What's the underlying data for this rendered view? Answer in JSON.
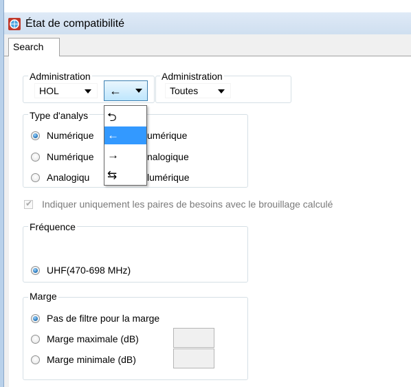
{
  "window": {
    "title": "État de compatibilité"
  },
  "tabs": [
    {
      "label": "Search"
    }
  ],
  "admin1": {
    "legend": "Administration",
    "value": "HOL"
  },
  "direction_combo": {
    "value": "←"
  },
  "admin2": {
    "legend": "Administration",
    "value": "Toutes"
  },
  "direction_options": [
    {
      "label": "⮌",
      "selected": false
    },
    {
      "label": "←",
      "selected": true
    },
    {
      "label": "→",
      "selected": false
    },
    {
      "label": "⇆",
      "selected": false
    }
  ],
  "analysis": {
    "legend": "Type d'analys",
    "options": [
      {
        "left": "Numérique",
        "right": "umérique",
        "selected": true
      },
      {
        "left": "Numérique",
        "right": "nalogique",
        "selected": false
      },
      {
        "left": "Analogiqu",
        "right": "lumérique",
        "selected": false
      }
    ]
  },
  "checkbox": {
    "label": "Indiquer uniquement les paires de besoins avec le brouillage calculé",
    "checked": true,
    "enabled": false
  },
  "frequency": {
    "legend": "Fréquence",
    "options": [
      {
        "label": "UHF(470-698 MHz)",
        "selected": true
      }
    ]
  },
  "margin": {
    "legend": "Marge",
    "options": [
      {
        "label": "Pas de filtre pour la marge",
        "selected": true
      },
      {
        "label": "Marge maximale (dB)",
        "selected": false,
        "value": ""
      },
      {
        "label": "Marge minimale (dB)",
        "selected": false,
        "value": ""
      }
    ]
  },
  "colors": {
    "accent": "#3399ff",
    "radio_on": "#1e6fb4",
    "group_border": "#d5dfe5"
  }
}
